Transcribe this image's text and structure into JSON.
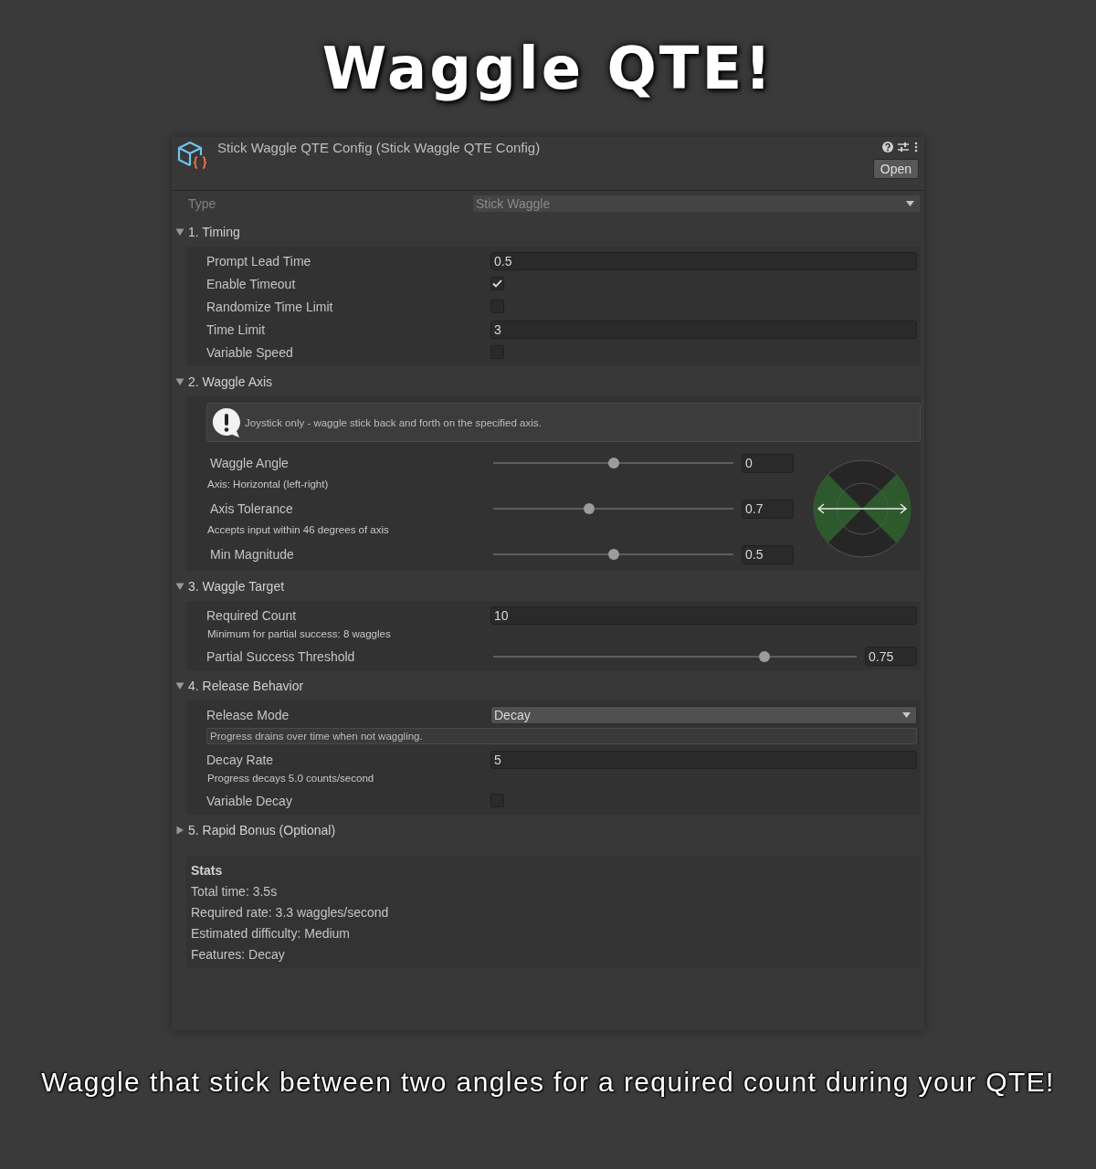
{
  "title": "Waggle QTE!",
  "inspector": {
    "header": {
      "title": "Stick Waggle QTE Config (Stick Waggle QTE Config)",
      "open_button": "Open"
    },
    "type_field": {
      "label": "Type",
      "value": "Stick Waggle",
      "disabled": true
    },
    "sections": [
      {
        "title": "1. Timing",
        "kind": "list",
        "expanded": true,
        "rows": [
          {
            "kind": "field",
            "label": "Prompt Lead Time",
            "value": "0.5"
          },
          {
            "kind": "checkbox",
            "label": "Enable Timeout",
            "checked": true
          },
          {
            "kind": "checkbox",
            "label": "Randomize Time Limit",
            "checked": false
          },
          {
            "kind": "field",
            "label": "Time Limit",
            "value": "3"
          },
          {
            "kind": "checkbox",
            "label": "Variable Speed",
            "checked": false
          }
        ]
      },
      {
        "title": "2. Waggle Axis",
        "kind": "axis",
        "expanded": true,
        "help": "Joystick only - waggle stick back and forth on the specified axis.",
        "rows": [
          {
            "kind": "slider",
            "label": "Waggle Angle",
            "level": 0.5,
            "value": "0"
          },
          {
            "kind": "note",
            "text": "Axis: Horizontal (left-right)"
          },
          {
            "kind": "slider",
            "label": "Axis Tolerance",
            "level": 0.4,
            "value": "0.7"
          },
          {
            "kind": "note",
            "text": "Accepts input within 46 degrees of axis"
          },
          {
            "kind": "slider",
            "label": "Min Magnitude",
            "level": 0.5,
            "value": "0.5"
          }
        ]
      },
      {
        "title": "3. Waggle Target",
        "kind": "list",
        "expanded": true,
        "rows": [
          {
            "kind": "field",
            "label": "Required Count",
            "value": "10"
          },
          {
            "kind": "note",
            "text": "Minimum for partial success: 8 waggles"
          },
          {
            "kind": "slider",
            "label": "Partial Success Threshold",
            "level": 0.745,
            "value": "0.75"
          }
        ]
      },
      {
        "title": "4. Release Behavior",
        "kind": "list",
        "expanded": true,
        "rows": [
          {
            "kind": "dropdown",
            "label": "Release Mode",
            "value": "Decay"
          },
          {
            "kind": "info",
            "text": "Progress drains over time when not waggling."
          },
          {
            "kind": "field",
            "label": "Decay Rate",
            "value": "5"
          },
          {
            "kind": "note",
            "text": "Progress decays 5.0 counts/second"
          },
          {
            "kind": "checkbox",
            "label": "Variable Decay",
            "checked": false
          }
        ]
      },
      {
        "title": "5. Rapid Bonus (Optional)",
        "expanded": false
      }
    ],
    "stats": {
      "title": "Stats",
      "lines": [
        "Total time: 3.5s",
        "Required rate: 3.3 waggles/second",
        "Estimated difficulty: Medium",
        "Features: Decay"
      ]
    }
  },
  "caption": "Waggle that stick between two angles for a required count during your QTE!"
}
